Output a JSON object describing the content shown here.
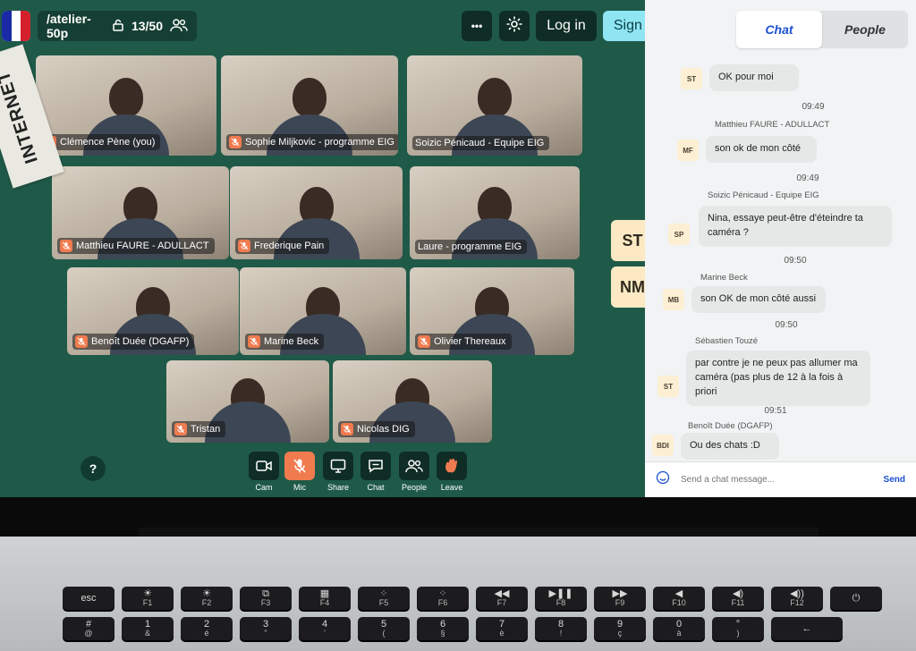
{
  "app": {
    "room_name": "/atelier-50p",
    "participant_count": "13/50",
    "more_label": "•••",
    "login_label": "Log in",
    "signup_label": "Sign up"
  },
  "participants": [
    {
      "name": "Clémence Pène (you)",
      "muted": true
    },
    {
      "name": "Sophie Miljkovic - programme EIG",
      "muted": true
    },
    {
      "name": "Soizic Pénicaud - Equipe EIG",
      "muted": false
    },
    {
      "name": "Matthieu FAURE - ADULLACT",
      "muted": true
    },
    {
      "name": "Frederique Pain",
      "muted": true
    },
    {
      "name": "Laure - programme EIG",
      "muted": false
    },
    {
      "name": "Benoît Duée (DGAFP)",
      "muted": true
    },
    {
      "name": "Marine Beck",
      "muted": true
    },
    {
      "name": "Olivier Thereaux",
      "muted": true
    },
    {
      "name": "Tristan",
      "muted": true
    },
    {
      "name": "Nicolas DIG",
      "muted": true
    }
  ],
  "side_avatars": [
    "ST",
    "NM"
  ],
  "controls": [
    {
      "label": "Cam",
      "icon": "camera-icon",
      "active": false
    },
    {
      "label": "Mic",
      "icon": "mic-off-icon",
      "active": true
    },
    {
      "label": "Share",
      "icon": "screen-share-icon",
      "active": false
    },
    {
      "label": "Chat",
      "icon": "chat-icon",
      "active": false
    },
    {
      "label": "People",
      "icon": "people-icon",
      "active": false
    },
    {
      "label": "Leave",
      "icon": "wave-hand-icon",
      "active": false
    }
  ],
  "help_label": "?",
  "chat": {
    "tabs": [
      {
        "label": "Chat",
        "active": true
      },
      {
        "label": "People",
        "active": false
      }
    ],
    "messages": [
      {
        "avatar": "ST",
        "sender": "",
        "time": "",
        "text": "OK pour moi"
      },
      {
        "avatar": "MF",
        "sender": "Matthieu FAURE - ADULLACT",
        "time": "09:49",
        "text": "son ok de mon côté"
      },
      {
        "avatar": "SP",
        "sender": "Soizic Pénicaud - Equipe EIG",
        "time": "09:49",
        "text": "Nina, essaye peut-être d'éteindre ta caméra ?"
      },
      {
        "avatar": "MB",
        "sender": "Marine Beck",
        "time": "09:50",
        "text": "son OK de mon côté aussi"
      },
      {
        "avatar": "ST",
        "sender": "Sébastien Touzé",
        "time": "09:50",
        "text": "par contre je ne peux pas allumer ma caméra (pas plus de 12 à la fois à priori"
      },
      {
        "avatar": "BDI",
        "sender": "Benoît Duée (DGAFP)",
        "time": "09:51",
        "text": "Ou des chats :D"
      }
    ],
    "placeholder": "Send a chat message...",
    "send_label": "Send"
  },
  "laptop": {
    "sticker_text": "INTERNET",
    "fn_keys": [
      {
        "main": "esc",
        "sub": ""
      },
      {
        "main": "☀",
        "sub": "F1"
      },
      {
        "main": "☀",
        "sub": "F2"
      },
      {
        "main": "⧉",
        "sub": "F3"
      },
      {
        "main": "▦",
        "sub": "F4"
      },
      {
        "main": "⁘",
        "sub": "F5"
      },
      {
        "main": "⁘",
        "sub": "F6"
      },
      {
        "main": "◀◀",
        "sub": "F7"
      },
      {
        "main": "▶❚❚",
        "sub": "F8"
      },
      {
        "main": "▶▶",
        "sub": "F9"
      },
      {
        "main": "◀",
        "sub": "F10"
      },
      {
        "main": "◀)",
        "sub": "F11"
      },
      {
        "main": "◀))",
        "sub": "F12"
      },
      {
        "main": "⏻",
        "sub": ""
      }
    ],
    "num_keys": [
      {
        "main": "#",
        "sub": "@"
      },
      {
        "main": "1",
        "sub": "&"
      },
      {
        "main": "2",
        "sub": "é"
      },
      {
        "main": "3",
        "sub": "\""
      },
      {
        "main": "4",
        "sub": "'"
      },
      {
        "main": "5",
        "sub": "("
      },
      {
        "main": "6",
        "sub": "§"
      },
      {
        "main": "7",
        "sub": "è"
      },
      {
        "main": "8",
        "sub": "!"
      },
      {
        "main": "9",
        "sub": "ç"
      },
      {
        "main": "0",
        "sub": "à"
      },
      {
        "main": "°",
        "sub": ")"
      },
      {
        "main": "←",
        "sub": ""
      }
    ]
  }
}
